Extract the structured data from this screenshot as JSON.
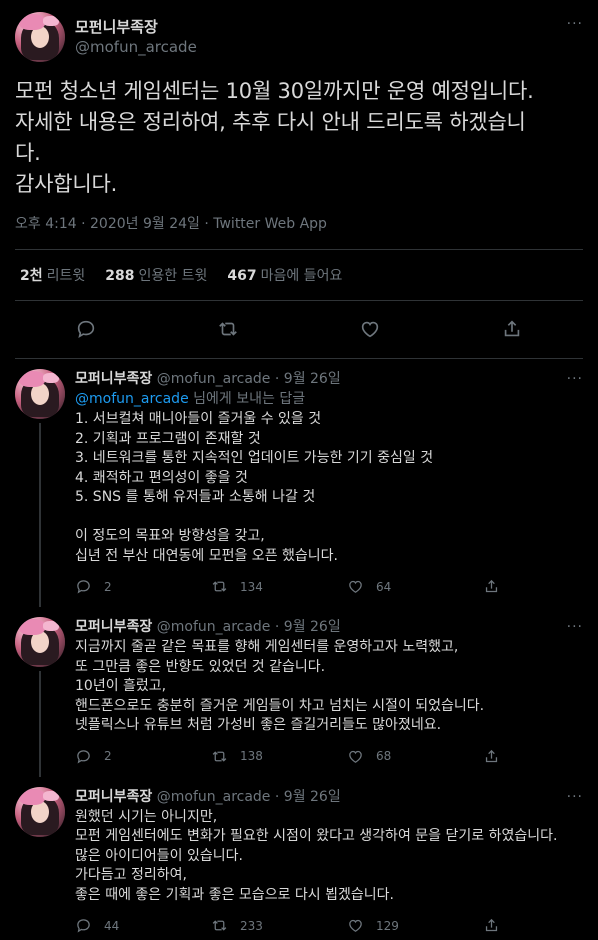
{
  "main": {
    "display_name": "모펀니부족장",
    "handle": "@mofun_arcade",
    "text": "모펀 청소년 게임센터는 10월 30일까지만 운영 예정입니다.\n자세한 내용은 정리하여, 추후 다시 안내 드리도록 하겠습니\n다.\n감사합니다.",
    "meta": "오후 4:14 · 2020년 9월 24일 · Twitter Web App",
    "stats": [
      {
        "num": "2천",
        "label": "리트윗"
      },
      {
        "num": "288",
        "label": "인용한 트윗"
      },
      {
        "num": "467",
        "label": "마음에 들어요"
      }
    ]
  },
  "replies": [
    {
      "display_name": "모퍼니부족장",
      "handle": "@mofun_arcade",
      "date": "9월 26일",
      "replying_mention": "@mofun_arcade",
      "replying_suffix": " 님에게 보내는 답글",
      "text": "1. 서브컬쳐 매니아들이 즐거울 수 있을 것\n2. 기획과 프로그램이 존재할 것\n3. 네트워크를 통한 지속적인 업데이트 가능한 기기 중심일 것\n4. 쾌적하고 편의성이 좋을 것\n5. SNS 를 통해 유저들과 소통해 나갈 것\n\n이 정도의 목표와 방향성을 갖고,\n십년 전 부산 대연동에 모펀을 오픈 했습니다.",
      "replies": "2",
      "retweets": "134",
      "likes": "64"
    },
    {
      "display_name": "모퍼니부족장",
      "handle": "@mofun_arcade",
      "date": "9월 26일",
      "text": "지금까지 줄곧 같은 목표를 향해 게임센터를 운영하고자 노력했고,\n또 그만큼 좋은 반향도 있었던 것 같습니다.\n10년이 흘렀고,\n핸드폰으로도 충분히 즐거운 게임들이 차고 넘치는 시절이 되었습니다.\n넷플릭스나 유튜브 처럼 가성비 좋은 즐길거리들도 많아졌네요.",
      "replies": "2",
      "retweets": "138",
      "likes": "68"
    },
    {
      "display_name": "모퍼니부족장",
      "handle": "@mofun_arcade",
      "date": "9월 26일",
      "text": "원했던 시기는 아니지만,\n모펀 게임센터에도 변화가 필요한 시점이 왔다고 생각하여 문을 닫기로 하였습니다.\n많은 아이디어들이 있습니다.\n가다듬고 정리하여,\n좋은 때에 좋은 기획과 좋은 모습으로 다시 뵙겠습니다.",
      "replies": "44",
      "retweets": "233",
      "likes": "129"
    }
  ],
  "ui": {
    "more": "···",
    "dot": " · "
  },
  "icons": [
    "reply-icon",
    "retweet-icon",
    "like-icon",
    "share-icon"
  ]
}
